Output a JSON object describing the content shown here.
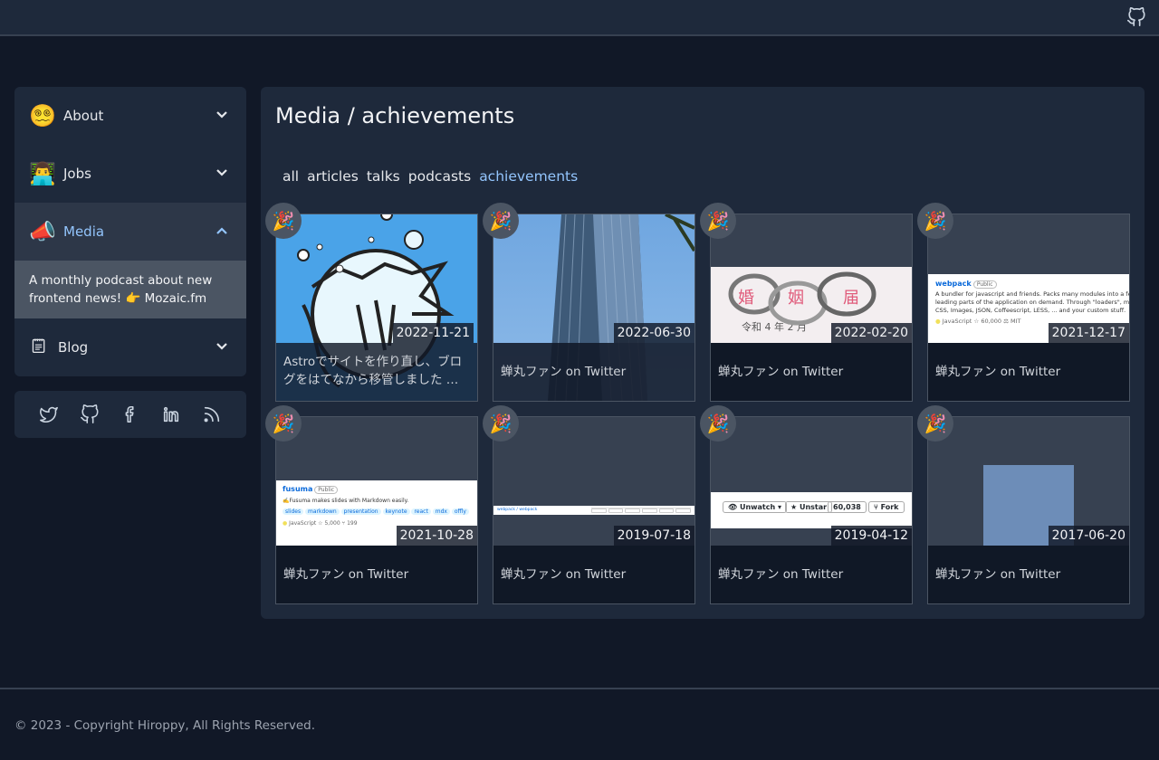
{
  "sidebar": {
    "items": [
      {
        "emoji": "😵‍💫",
        "label": "About"
      },
      {
        "emoji": "👨‍💻",
        "label": "Jobs"
      },
      {
        "emoji": "📣",
        "label": "Media"
      },
      {
        "emoji": "🗒",
        "label": "Blog"
      }
    ],
    "media_description": "A monthly podcast about new frontend news! 👉 Mozaic.fm"
  },
  "social": [
    "twitter-icon",
    "github-icon",
    "facebook-icon",
    "linkedin-icon",
    "rss-icon"
  ],
  "main": {
    "title": "Media / achievements",
    "tabs": [
      "all",
      "articles",
      "talks",
      "podcasts",
      "achievements"
    ],
    "active_tab": "achievements"
  },
  "cards": [
    {
      "badge": "🎉",
      "date": "2022-11-21",
      "title": "Astroでサイトを作り直し、ブログをはてなから移管しました …"
    },
    {
      "badge": "🎉",
      "date": "2022-06-30",
      "title": "蝉丸ファン on Twitter"
    },
    {
      "badge": "🎉",
      "date": "2022-02-20",
      "title": "蝉丸ファン on Twitter",
      "image_text": [
        "婚",
        "姻",
        "届",
        "令和 4 年 2 月"
      ]
    },
    {
      "badge": "🎉",
      "date": "2021-12-17",
      "title": "蝉丸ファン on Twitter",
      "image_text": [
        "webpack",
        "Public",
        "A bundler for javascript and friends. Packs many modules into a few",
        "leading parts of the application on demand. Through \"loaders\", mo",
        "CSS, Images, JSON, Coffeescript, LESS, ... and your custom stuff.",
        "JavaScript",
        "60,000",
        "MIT"
      ]
    },
    {
      "badge": "🎉",
      "date": "2021-10-28",
      "title": "蝉丸ファン on Twitter",
      "image_text": [
        "fusuma",
        "Public",
        "✍️Fusuma makes slides with Markdown easily.",
        "slides",
        "markdown",
        "presentation",
        "keynote",
        "react",
        "mdx",
        "offly",
        "JavaScript",
        "5,000",
        "199"
      ]
    },
    {
      "badge": "🎉",
      "date": "2019-07-18",
      "title": "蝉丸ファン on Twitter",
      "image_text": [
        "webpack / webpack"
      ]
    },
    {
      "badge": "🎉",
      "date": "2019-04-12",
      "title": "蝉丸ファン on Twitter",
      "image_text": [
        "Unwatch",
        "Unstar",
        "60,038",
        "Fork"
      ]
    },
    {
      "badge": "🎉",
      "date": "2017-06-20",
      "title": "蝉丸ファン on Twitter"
    }
  ],
  "footer": {
    "copyright": "© 2023 - Copyright Hiroppy, All Rights Reserved."
  },
  "colors": {
    "accent": "#93c5fd",
    "background": "#111827",
    "panel": "#1e293b"
  }
}
